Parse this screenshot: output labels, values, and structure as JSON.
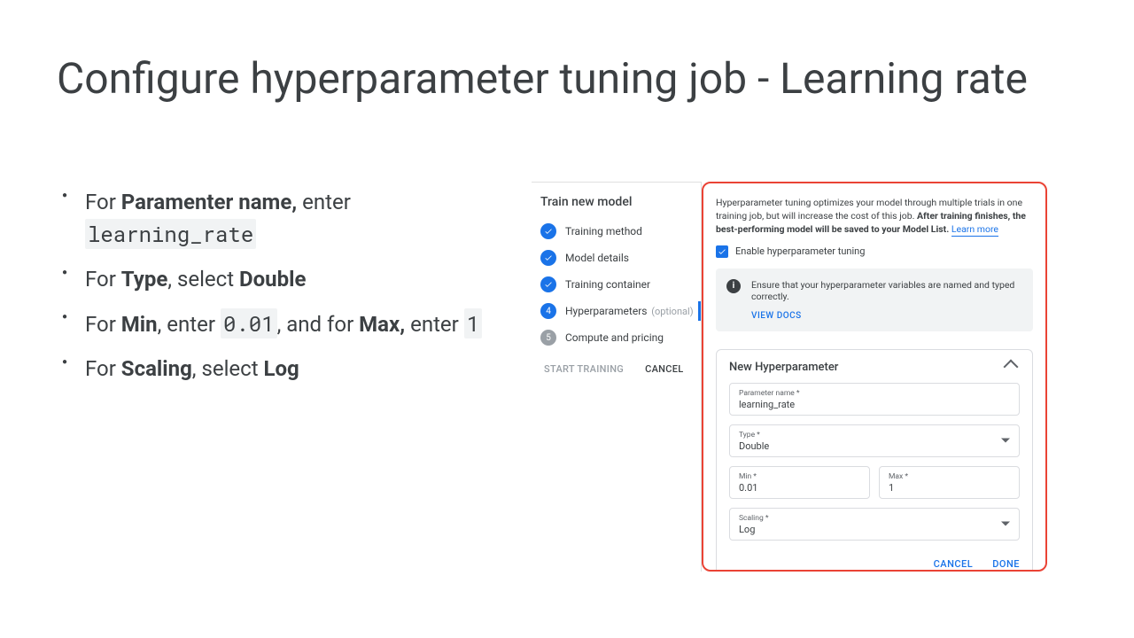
{
  "title": "Configure hyperparameter tuning job - Learning rate",
  "bullets": {
    "b1_prefix": "For ",
    "b1_bold": "Paramenter name,",
    "b1_mid": " enter ",
    "b1_code": "learning_rate",
    "b2_prefix": "For ",
    "b2_bold1": "Type",
    "b2_mid": ", select ",
    "b2_bold2": "Double",
    "b3_prefix": "For ",
    "b3_bold1": "Min",
    "b3_mid1": ", enter ",
    "b3_code1": "0.01",
    "b3_mid2": ", and for ",
    "b3_bold2": "Max,",
    "b3_mid3": " enter ",
    "b3_code2": "1",
    "b4_prefix": "For ",
    "b4_bold1": "Scaling",
    "b4_mid": ", select ",
    "b4_bold2": "Log"
  },
  "left_pane": {
    "title": "Train new model",
    "steps": {
      "s1": "Training method",
      "s2": "Model details",
      "s3": "Training container",
      "s4": "Hyperparameters",
      "s4_optional": " (optional)",
      "s5": "Compute and pricing",
      "num4": "4",
      "num5": "5"
    },
    "start": "START TRAINING",
    "cancel": "CANCEL"
  },
  "right_pane": {
    "intro_plain": "Hyperparameter tuning optimizes your model through multiple trials in one training job, but will increase the cost of this job. ",
    "intro_bold": "After training finishes, the best-performing model will be saved to your Model List.",
    "learn_more": "Learn more",
    "enable_label": "Enable hyperparameter tuning",
    "banner_msg": "Ensure that your hyperparameter variables are named and typed correctly.",
    "view_docs": "VIEW DOCS",
    "card_title": "New Hyperparameter",
    "fields": {
      "param_label": "Parameter name *",
      "param_value": "learning_rate",
      "type_label": "Type *",
      "type_value": "Double",
      "min_label": "Min *",
      "min_value": "0.01",
      "max_label": "Max *",
      "max_value": "1",
      "scaling_label": "Scaling *",
      "scaling_value": "Log"
    },
    "cancel": "CANCEL",
    "done": "DONE"
  }
}
